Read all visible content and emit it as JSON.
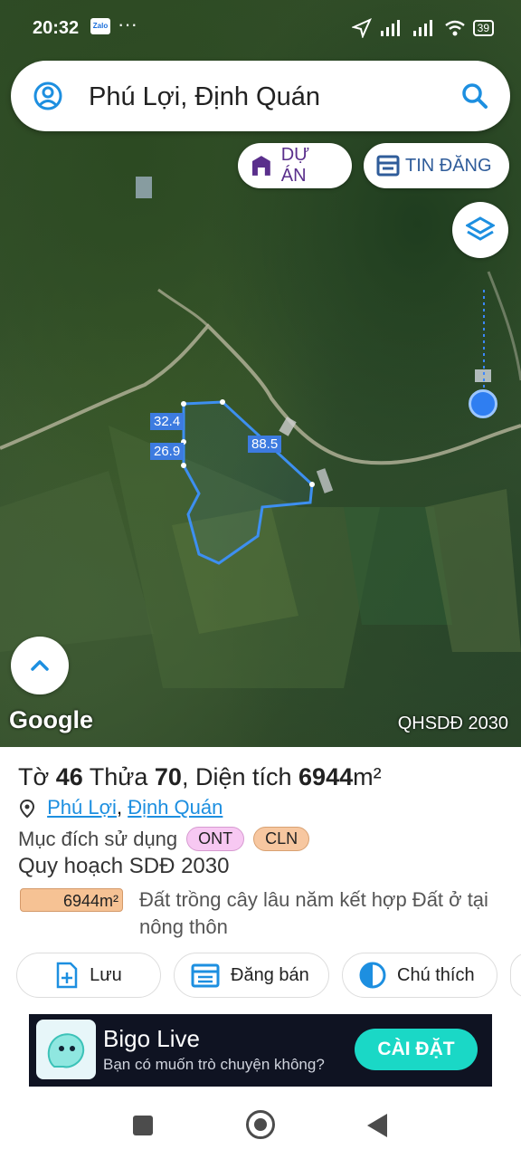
{
  "status_bar": {
    "time": "20:32",
    "zalo": "Zalo",
    "more": "···",
    "battery": "39"
  },
  "search": {
    "value": "Phú Lợi, Định Quán"
  },
  "map_buttons": {
    "du_an": "DỰ ÁN",
    "tin_dang": "TIN ĐĂNG"
  },
  "parcel_edges": {
    "edge1": "32.4",
    "edge2": "26.9",
    "edge3": "88.5"
  },
  "map_footer": {
    "google": "Google",
    "layer_label": "QHSDĐ 2030"
  },
  "parcel": {
    "to_label": "Tờ",
    "to_value": "46",
    "thua_label": "Thửa",
    "thua_value": "70",
    "dientich_label": ", Diện tích",
    "dientich_value": "6944",
    "unit": "m²",
    "location_ward": "Phú Lợi",
    "location_sep": ",",
    "location_district": "Định Quán",
    "muc_dich_label": "Mục đích sử dụng",
    "tags": [
      "ONT",
      "CLN"
    ],
    "quy_hoach_label": "Quy hoạch SDĐ 2030",
    "area_tag": "6944m²",
    "area_desc": "Đất trồng cây lâu năm kết hợp Đất ở tại nông thôn"
  },
  "actions": {
    "luu": "Lưu",
    "dang_ban": "Đăng bán",
    "chu_thich": "Chú thích"
  },
  "ad": {
    "name": "Bigo Live",
    "subtitle": "Bạn có muốn trò chuyện không?",
    "cta": "CÀI ĐẶT"
  },
  "colors": {
    "accent": "#1d8fe0",
    "parcel_line": "#3d8ff0",
    "ont_tag": "#f7c8f2",
    "cln_tag": "#f7c7a0",
    "ad_cta": "#1ad8c6"
  }
}
